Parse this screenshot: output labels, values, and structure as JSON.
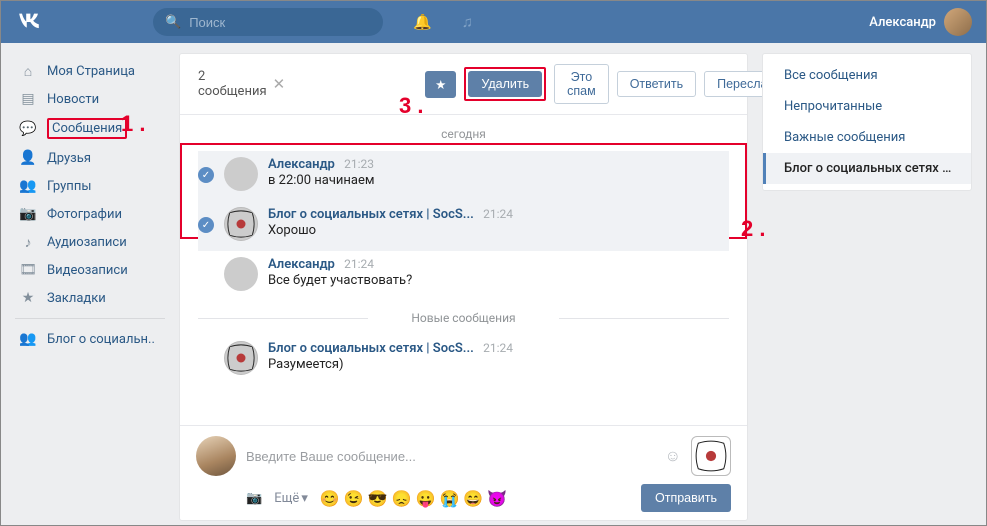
{
  "header": {
    "search_placeholder": "Поиск",
    "username": "Александр"
  },
  "leftnav": {
    "items": [
      {
        "icon": "home",
        "label": "Моя Страница"
      },
      {
        "icon": "news",
        "label": "Новости"
      },
      {
        "icon": "msg",
        "label": "Сообщения",
        "highlight": true
      },
      {
        "icon": "user",
        "label": "Друзья"
      },
      {
        "icon": "group",
        "label": "Группы"
      },
      {
        "icon": "photo",
        "label": "Фотографии"
      },
      {
        "icon": "audio",
        "label": "Аудиозаписи"
      },
      {
        "icon": "video",
        "label": "Видеозаписи"
      },
      {
        "icon": "star",
        "label": "Закладки"
      }
    ],
    "extra": {
      "icon": "group2",
      "label": "Блог о социальн.."
    }
  },
  "toolbar": {
    "selected_text": "2 сообщения",
    "star_symbol": "★",
    "delete_label": "Удалить",
    "spam_label": "Это спам",
    "reply_label": "Ответить",
    "forward_label": "Переслать"
  },
  "day_separator": "сегодня",
  "new_separator": "Новые сообщения",
  "messages": [
    {
      "from": "Александр",
      "time": "21:23",
      "text": "в 22:00 начинаем",
      "avatar": "user",
      "selected": true
    },
    {
      "from": "Блог о социальных сетях | SocS...",
      "time": "21:24",
      "text": "Хорошо",
      "avatar": "group",
      "selected": true
    },
    {
      "from": "Александр",
      "time": "21:24",
      "text": "Все будет участвовать?",
      "avatar": "user",
      "selected": false
    },
    {
      "from": "Блог о социальных сетях | SocS...",
      "time": "21:24",
      "text": "Разумеется)",
      "avatar": "group",
      "selected": false
    }
  ],
  "compose": {
    "placeholder": "Введите Ваше сообщение...",
    "more_label": "Ещё",
    "send_label": "Отправить",
    "emojis": [
      "😊",
      "😉",
      "😎",
      "😞",
      "😛",
      "😭",
      "😄",
      "😈"
    ]
  },
  "filters": [
    {
      "label": "Все сообщения"
    },
    {
      "label": "Непрочитанные"
    },
    {
      "label": "Важные сообщения"
    },
    {
      "label": "Блог о социальных сетях | ...",
      "active": true
    }
  ],
  "annotations": {
    "n1": "1 .",
    "n2": "2 .",
    "n3": "3 ."
  }
}
